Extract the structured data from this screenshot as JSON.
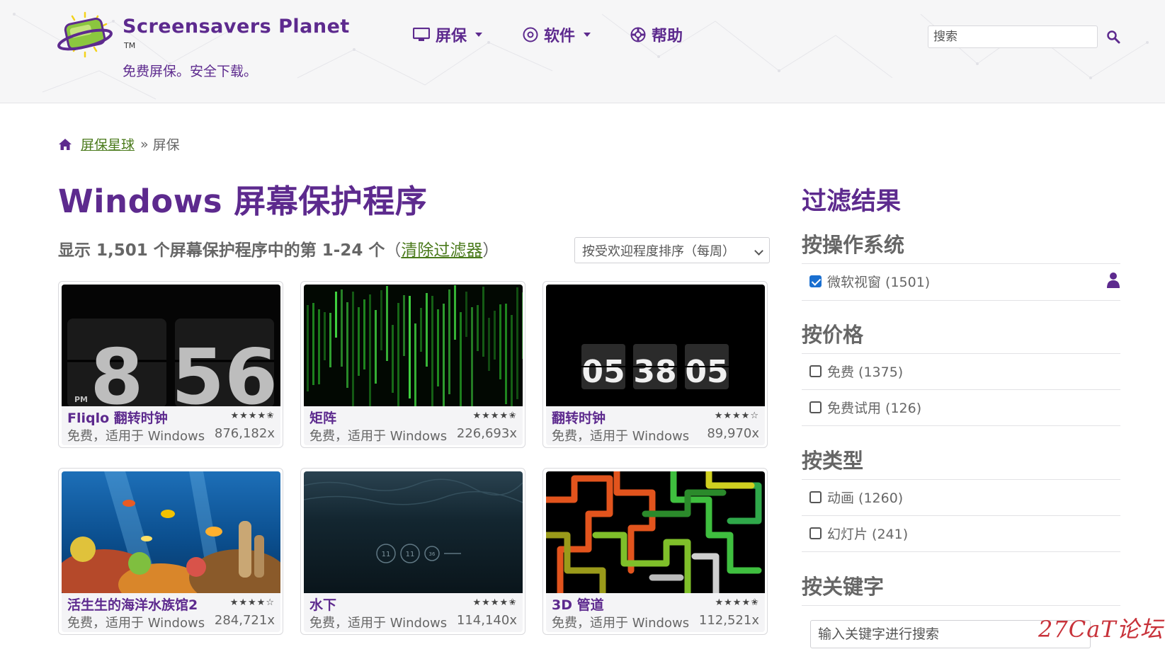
{
  "header": {
    "brand": "Screensavers Planet",
    "tm": "TM",
    "tagline": "免费屏保。安全下载。",
    "nav": [
      {
        "label": "屏保",
        "icon": "monitor-icon",
        "dropdown": true
      },
      {
        "label": "软件",
        "icon": "disc-icon",
        "dropdown": true
      },
      {
        "label": "帮助",
        "icon": "lifebuoy-icon",
        "dropdown": false
      }
    ],
    "search_placeholder": "搜索",
    "accent_color": "#5d2a8e"
  },
  "breadcrumb": {
    "home_label": "屏保星球",
    "separator": "»",
    "current": "屏保"
  },
  "main": {
    "title": "Windows 屏幕保护程序",
    "results_text": "显示 1,501 个屏幕保护程序中的第 1-24 个",
    "clear_filter": "清除过滤器",
    "paren_open": "（",
    "paren_close": "）",
    "sort_value": "按受欢迎程度排序（每周）"
  },
  "cards": [
    {
      "name": "Fliqlo 翻转时钟",
      "stars": "★★★★✬",
      "rating": 4.5,
      "subtitle": "免费，适用于 Windows",
      "count": "876,182x"
    },
    {
      "name": "矩阵",
      "stars": "★★★★✬",
      "rating": 4.5,
      "subtitle": "免费，适用于 Windows",
      "count": "226,693x"
    },
    {
      "name": "翻转时钟",
      "stars": "★★★★☆",
      "rating": 4,
      "subtitle": "免费，适用于 Windows",
      "count": "89,970x"
    },
    {
      "name": "活生生的海洋水族馆2",
      "stars": "★★★★☆",
      "rating": 4,
      "subtitle": "免费，适用于 Windows",
      "count": "284,721x"
    },
    {
      "name": "水下",
      "stars": "★★★★✬",
      "rating": 4.5,
      "subtitle": "免费，适用于 Windows",
      "count": "114,140x"
    },
    {
      "name": "3D 管道",
      "stars": "★★★★✬",
      "rating": 4.5,
      "subtitle": "免费，适用于 Windows",
      "count": "112,521x"
    }
  ],
  "thumb_text": {
    "fliqlo_hour": "8",
    "fliqlo_min": "56",
    "fliqlo_pm": "PM",
    "flip_h": "05",
    "flip_m": "38",
    "flip_s": "05",
    "uw_1": "11",
    "uw_2": "11",
    "uw_3": "36"
  },
  "sidebar": {
    "title": "过滤结果",
    "sections": [
      {
        "title": "按操作系统",
        "options": [
          {
            "label": "微软视窗 (1501)",
            "checked": true
          }
        ]
      },
      {
        "title": "按价格",
        "options": [
          {
            "label": "免费 (1375)",
            "checked": false
          },
          {
            "label": "免费试用 (126)",
            "checked": false
          }
        ]
      },
      {
        "title": "按类型",
        "options": [
          {
            "label": "动画 (1260)",
            "checked": false
          },
          {
            "label": "幻灯片 (241)",
            "checked": false
          }
        ]
      },
      {
        "title": "按关键字",
        "options": []
      }
    ],
    "keyword_placeholder": "输入关键字进行搜索"
  },
  "watermark": "27CaT论坛"
}
